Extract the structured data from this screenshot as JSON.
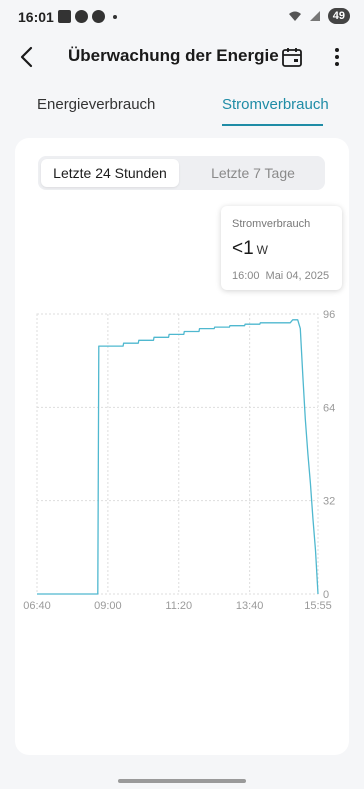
{
  "status_bar": {
    "time": "16:01",
    "battery": "49"
  },
  "header": {
    "title": "Überwachung der Energie"
  },
  "tabs": [
    {
      "label": "Energieverbrauch",
      "active": false
    },
    {
      "label": "Stromverbrauch",
      "active": true
    }
  ],
  "segment": {
    "options": [
      "Letzte 24 Stunden",
      "Letzte 7 Tage"
    ],
    "selected": "Letzte 24 Stunden"
  },
  "tooltip": {
    "label": "Stromverbrauch",
    "value": "<1",
    "unit": "W",
    "time": "16:00",
    "date": "Mai 04, 2025"
  },
  "colors": {
    "accent": "#1f8ca6",
    "line": "#4fb8cf",
    "grid": "#dddddd"
  },
  "icons": {
    "back": "chevron-left-icon",
    "calendar": "calendar-icon",
    "more": "more-vertical-icon"
  },
  "chart_data": {
    "type": "line",
    "x_ticks": [
      "06:40",
      "09:00",
      "11:20",
      "13:40",
      "15:55"
    ],
    "y_ticks": [
      "0",
      "32",
      "64",
      "96"
    ],
    "ylim": [
      0,
      96
    ],
    "y_axis_position": "right",
    "grid": true,
    "series": [
      {
        "x": [
          "06:40",
          "07:00",
          "07:20",
          "07:40",
          "08:00",
          "08:20",
          "08:40",
          "08:42",
          "09:00",
          "09:30",
          "09:31",
          "10:00",
          "10:01",
          "10:30",
          "10:31",
          "11:00",
          "11:01",
          "11:30",
          "11:31",
          "12:00",
          "12:01",
          "12:30",
          "12:31",
          "13:00",
          "13:01",
          "13:30",
          "13:31",
          "14:00",
          "14:01",
          "14:30",
          "14:31",
          "15:00",
          "15:05",
          "15:15",
          "15:20",
          "15:25",
          "15:30",
          "15:35",
          "15:40",
          "15:45",
          "15:50",
          "15:55"
        ],
        "values": [
          0,
          0,
          0,
          0,
          0,
          0,
          0,
          85,
          85,
          85,
          86,
          86,
          87,
          87,
          88,
          88,
          89,
          89,
          90,
          90,
          91,
          91,
          91.5,
          91.5,
          92,
          92,
          92.5,
          92.5,
          93,
          93,
          93,
          93,
          94,
          94,
          91,
          75,
          60,
          48,
          38,
          26,
          15,
          0
        ]
      }
    ]
  }
}
